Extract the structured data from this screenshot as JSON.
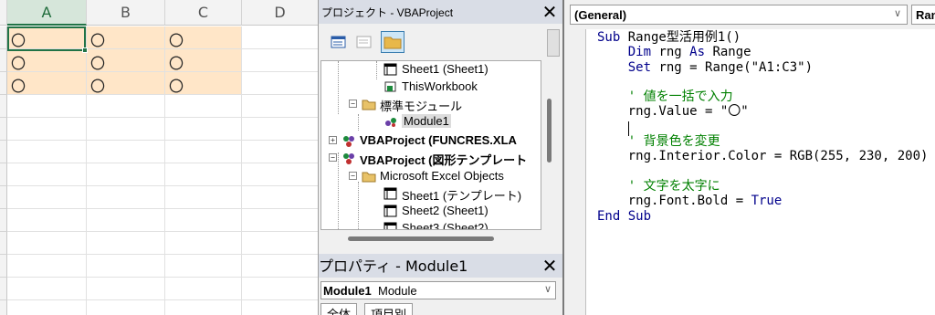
{
  "excel": {
    "columns": [
      "A",
      "B",
      "C",
      "D"
    ],
    "rows": [
      [
        "〇",
        "〇",
        "〇",
        ""
      ],
      [
        "〇",
        "〇",
        "〇",
        ""
      ],
      [
        "〇",
        "〇",
        "〇",
        ""
      ]
    ],
    "fill_color": "#ffe6c8",
    "selection_color": "#217346"
  },
  "project_panel": {
    "title": "プロジェクト - VBAProject",
    "close": "✕",
    "tree": [
      "Sheet1 (Sheet1)",
      "ThisWorkbook",
      "標準モジュール",
      "Module1",
      "VBAProject (FUNCRES.XLA",
      "VBAProject (図形テンプレート",
      "Microsoft Excel Objects",
      "Sheet1 (テンプレート)",
      "Sheet2 (Sheet1)",
      "Sheet3 (Sheet2)"
    ]
  },
  "properties_panel": {
    "title": "プロパティ - Module1",
    "close": "✕",
    "object_name": "Module1",
    "object_type": "Module",
    "tabs": [
      "全体",
      "項目別"
    ]
  },
  "code_window": {
    "object_combo": "(General)",
    "proc_combo": "Ran",
    "lines": [
      [
        {
          "t": "Sub ",
          "c": "kw"
        },
        {
          "t": "Range型活用例1()",
          "c": ""
        }
      ],
      [
        {
          "t": "    Dim ",
          "c": "kw"
        },
        {
          "t": "rng ",
          "c": ""
        },
        {
          "t": "As ",
          "c": "kw"
        },
        {
          "t": "Range",
          "c": ""
        }
      ],
      [
        {
          "t": "    Set ",
          "c": "kw"
        },
        {
          "t": "rng = Range(\"A1:C3\")",
          "c": ""
        }
      ],
      [
        {
          "t": "",
          "c": ""
        }
      ],
      [
        {
          "t": "    ' 値を一括で入力",
          "c": "cm"
        }
      ],
      [
        {
          "t": "    rng.Value = \"〇\"",
          "c": ""
        }
      ],
      [
        {
          "t": "",
          "c": ""
        }
      ],
      [
        {
          "t": "    ' 背景色を変更",
          "c": "cm"
        }
      ],
      [
        {
          "t": "    rng.Interior.Color = RGB(255, 230, 200)",
          "c": ""
        }
      ],
      [
        {
          "t": "",
          "c": ""
        }
      ],
      [
        {
          "t": "    ' 文字を太字に",
          "c": "cm"
        }
      ],
      [
        {
          "t": "    rng.Font.Bold = ",
          "c": ""
        },
        {
          "t": "True",
          "c": "kw"
        }
      ],
      [
        {
          "t": "End Sub",
          "c": "kw"
        }
      ]
    ]
  }
}
